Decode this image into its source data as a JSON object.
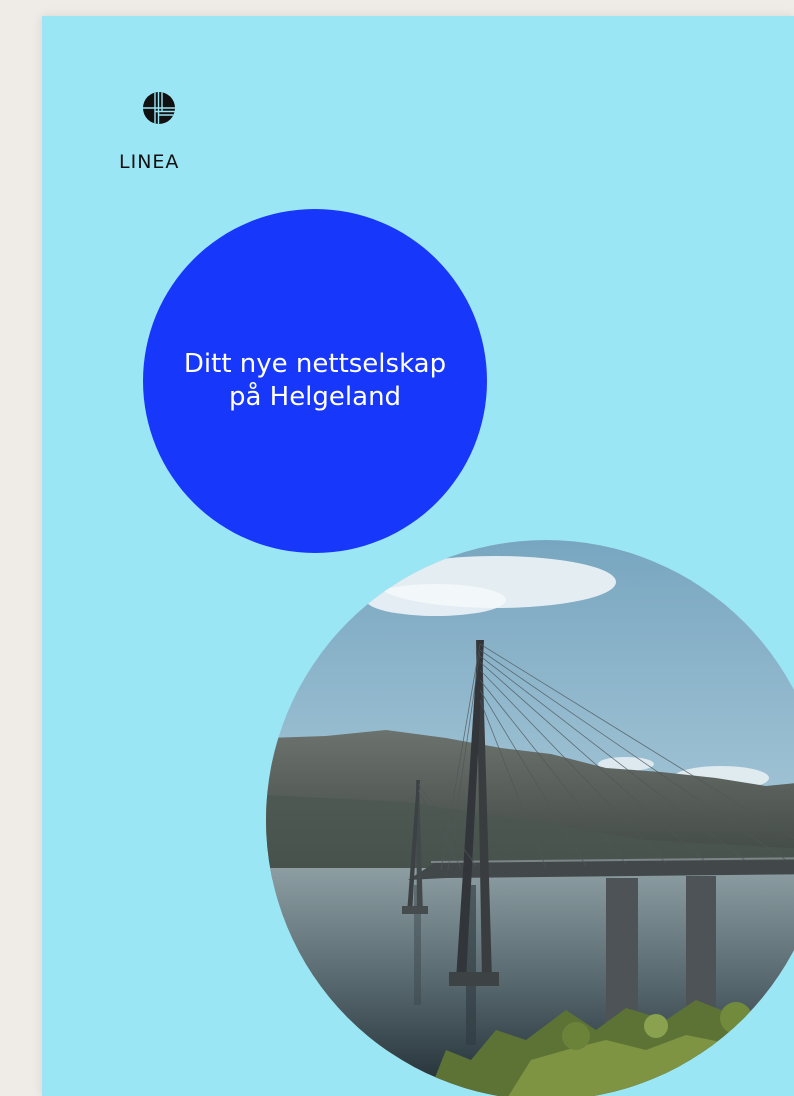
{
  "brand": {
    "name": "LINEA",
    "logo_icon": "linea-grid-logo-icon"
  },
  "headline": "Ditt nye nettselskap på Helgeland",
  "photo": {
    "subject": "bridge-over-fjord-photo"
  },
  "colors": {
    "page_background": "#9be6f4",
    "accent_circle": "#1737fb",
    "headline_text": "#ffffff",
    "logo": "#111111",
    "outer_background": "#efebe6"
  }
}
